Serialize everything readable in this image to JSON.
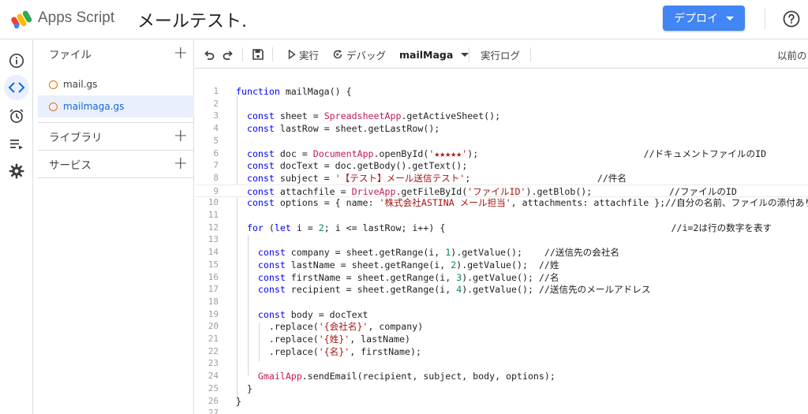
{
  "header": {
    "app_name": "Apps Script",
    "project_title": "メールテスト.",
    "deploy_label": "デプロイ",
    "help_icon": "help-circle-icon"
  },
  "rail": {
    "items": [
      {
        "icon": "info-icon"
      },
      {
        "icon": "code-icon"
      },
      {
        "icon": "alarm-clock-icon"
      },
      {
        "icon": "execution-list-icon"
      },
      {
        "icon": "gear-icon"
      }
    ]
  },
  "files": {
    "header": "ファイル",
    "items": [
      "mail.gs",
      "mailmaga.gs"
    ],
    "active": "mailmaga.gs",
    "libraries": "ライブラリ",
    "services": "サービス"
  },
  "toolbar": {
    "run": "実行",
    "debug": "デバッグ",
    "function": "mailMaga",
    "log": "実行ログ",
    "history": "以前の"
  },
  "colors": {
    "accent": "#4285f4",
    "keyword": "#0000ff",
    "class": "#c2185b",
    "string": "#a31515",
    "number": "#098658",
    "active_bg": "#e8f0fe"
  },
  "code": {
    "lines": [
      [
        {
          "t": "function",
          "c": "kw"
        },
        {
          "t": " mailMaga() {"
        }
      ],
      [],
      [
        {
          "t": "  "
        },
        {
          "t": "const",
          "c": "kw"
        },
        {
          "t": " sheet = "
        },
        {
          "t": "SpreadsheetApp",
          "c": "cls"
        },
        {
          "t": ".getActiveSheet();"
        }
      ],
      [
        {
          "t": "  "
        },
        {
          "t": "const",
          "c": "kw"
        },
        {
          "t": " lastRow = sheet.getLastRow();"
        }
      ],
      [],
      [
        {
          "t": "  "
        },
        {
          "t": "const",
          "c": "kw"
        },
        {
          "t": " doc = "
        },
        {
          "t": "DocumentApp",
          "c": "cls"
        },
        {
          "t": ".openById("
        },
        {
          "t": "'★★★★★'",
          "c": "str"
        },
        {
          "t": ");                              "
        },
        {
          "t": "//ドキュメントファイルのID",
          "c": "cm"
        }
      ],
      [
        {
          "t": "  "
        },
        {
          "t": "const",
          "c": "kw"
        },
        {
          "t": " docText = doc.getBody().getText();"
        }
      ],
      [
        {
          "t": "  "
        },
        {
          "t": "const",
          "c": "kw"
        },
        {
          "t": " subject = "
        },
        {
          "t": "'【テスト】メール送信テスト'",
          "c": "str"
        },
        {
          "t": ";                       "
        },
        {
          "t": "//件名",
          "c": "cm"
        }
      ],
      [
        {
          "t": "  "
        },
        {
          "t": "const",
          "c": "kw"
        },
        {
          "t": " attachfile = "
        },
        {
          "t": "DriveApp",
          "c": "cls"
        },
        {
          "t": ".getFileById("
        },
        {
          "t": "'ファイルID'",
          "c": "str"
        },
        {
          "t": ").getBlob();              "
        },
        {
          "t": "//ファイルのID",
          "c": "cm"
        }
      ],
      [
        {
          "t": "  "
        },
        {
          "t": "const",
          "c": "kw"
        },
        {
          "t": " options = { name: "
        },
        {
          "t": "'株式会社ASTINA メール担当'",
          "c": "str"
        },
        {
          "t": ", attachments: attachfile };"
        },
        {
          "t": "//自分の名前、ファイルの添付あり",
          "c": "cm"
        }
      ],
      [],
      [
        {
          "t": "  "
        },
        {
          "t": "for",
          "c": "kw"
        },
        {
          "t": " ("
        },
        {
          "t": "let",
          "c": "kw"
        },
        {
          "t": " i = "
        },
        {
          "t": "2",
          "c": "num"
        },
        {
          "t": "; i <= lastRow; i++) {                                         "
        },
        {
          "t": "//i=2は行の数字を表す",
          "c": "cm"
        }
      ],
      [],
      [
        {
          "t": "    "
        },
        {
          "t": "const",
          "c": "kw"
        },
        {
          "t": " company = sheet.getRange(i, "
        },
        {
          "t": "1",
          "c": "num"
        },
        {
          "t": ").getValue();    "
        },
        {
          "t": "//送信先の会社名",
          "c": "cm"
        }
      ],
      [
        {
          "t": "    "
        },
        {
          "t": "const",
          "c": "kw"
        },
        {
          "t": " lastName = sheet.getRange(i, "
        },
        {
          "t": "2",
          "c": "num"
        },
        {
          "t": ").getValue();  "
        },
        {
          "t": "//姓",
          "c": "cm"
        }
      ],
      [
        {
          "t": "    "
        },
        {
          "t": "const",
          "c": "kw"
        },
        {
          "t": " firstName = sheet.getRange(i, "
        },
        {
          "t": "3",
          "c": "num"
        },
        {
          "t": ").getValue(); "
        },
        {
          "t": "//名",
          "c": "cm"
        }
      ],
      [
        {
          "t": "    "
        },
        {
          "t": "const",
          "c": "kw"
        },
        {
          "t": " recipient = sheet.getRange(i, "
        },
        {
          "t": "4",
          "c": "num"
        },
        {
          "t": ").getValue(); "
        },
        {
          "t": "//送信先のメールアドレス",
          "c": "cm"
        }
      ],
      [],
      [
        {
          "t": "    "
        },
        {
          "t": "const",
          "c": "kw"
        },
        {
          "t": " body = docText"
        }
      ],
      [
        {
          "t": "      .replace("
        },
        {
          "t": "'{会社名}'",
          "c": "str"
        },
        {
          "t": ", company)"
        }
      ],
      [
        {
          "t": "      .replace("
        },
        {
          "t": "'{姓}'",
          "c": "str"
        },
        {
          "t": ", lastName)"
        }
      ],
      [
        {
          "t": "      .replace("
        },
        {
          "t": "'{名}'",
          "c": "str"
        },
        {
          "t": ", firstName);"
        }
      ],
      [],
      [
        {
          "t": "    "
        },
        {
          "t": "GmailApp",
          "c": "cls"
        },
        {
          "t": ".sendEmail(recipient, subject, body, options);"
        }
      ],
      [
        {
          "t": "  }"
        }
      ],
      [
        {
          "t": "}"
        }
      ],
      []
    ]
  }
}
